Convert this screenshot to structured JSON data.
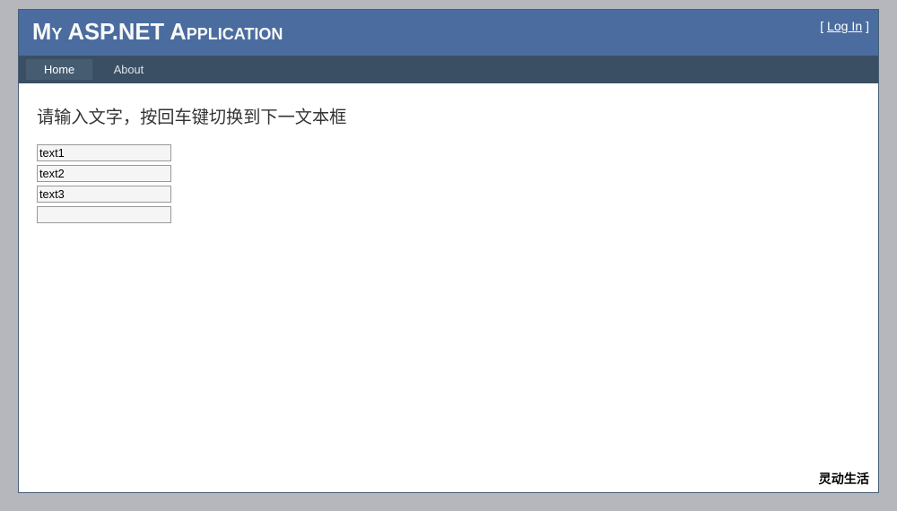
{
  "header": {
    "title": "My ASP.NET Application",
    "login_prefix": "[ ",
    "login_link": "Log In",
    "login_suffix": " ]"
  },
  "nav": {
    "items": [
      {
        "label": "Home",
        "selected": true
      },
      {
        "label": "About",
        "selected": false
      }
    ]
  },
  "main": {
    "heading": "请输入文字，按回车键切换到下一文本框",
    "inputs": [
      {
        "value": "text1"
      },
      {
        "value": "text2"
      },
      {
        "value": "text3"
      },
      {
        "value": ""
      }
    ]
  },
  "footer": {
    "text": "灵动生活"
  }
}
